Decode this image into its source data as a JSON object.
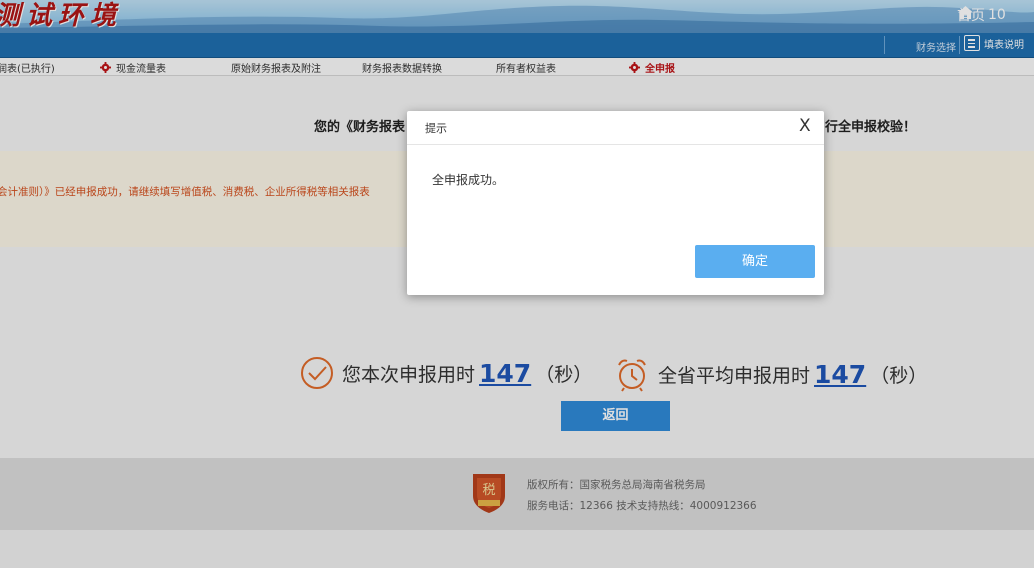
{
  "banner": {
    "env_title": "测试环境",
    "home_label": "首页",
    "home_suffix": "10",
    "home_icon": "home-icon"
  },
  "topbar": {
    "finance_select_label": "财务选择",
    "fill_help_label": "填表说明",
    "fill_help_icon": "document-lines-icon"
  },
  "tabs": [
    {
      "label": "润表(已执行)",
      "icon": null,
      "active": false
    },
    {
      "label": "现金流量表",
      "icon": "gear-icon",
      "active": false
    },
    {
      "label": "原始财务报表及附注",
      "icon": null,
      "active": false
    },
    {
      "label": "财务报表数据转换",
      "icon": null,
      "active": false
    },
    {
      "label": "所有者权益表",
      "icon": null,
      "active": false
    },
    {
      "label": "全申报",
      "icon": "gear-icon",
      "active": true
    }
  ],
  "main": {
    "notice_left": "您的《财务报表",
    "notice_right": "行全申报校验！",
    "alert_text": "会计准则）》已经申报成功，请继续填写增值税、消费税、企业所得税等相关报表",
    "self_time_label": "您本次申报用时",
    "self_time_value": "147",
    "self_time_unit": "（秒）",
    "avg_time_label": "全省平均申报用时",
    "avg_time_value": "147",
    "avg_time_unit": "（秒）",
    "back_label": "返回",
    "check_icon": "check-circle-icon",
    "clock_icon": "alarm-clock-icon"
  },
  "footer": {
    "copyright": "版权所有：国家税务总局海南省税务局",
    "contact": "服务电话：12366 技术支持热线：4000912366",
    "badge_text": "税徽图案",
    "badge_icon": "tax-emblem-icon"
  },
  "dialog": {
    "title": "提示",
    "close_label": "X",
    "message": "全申报成功。",
    "ok_label": "确定"
  },
  "colors": {
    "accent_blue": "#1f6fb0",
    "alert_orange": "#d4501f",
    "link_blue": "#1f56b8",
    "ok_button": "#5aaef0"
  }
}
